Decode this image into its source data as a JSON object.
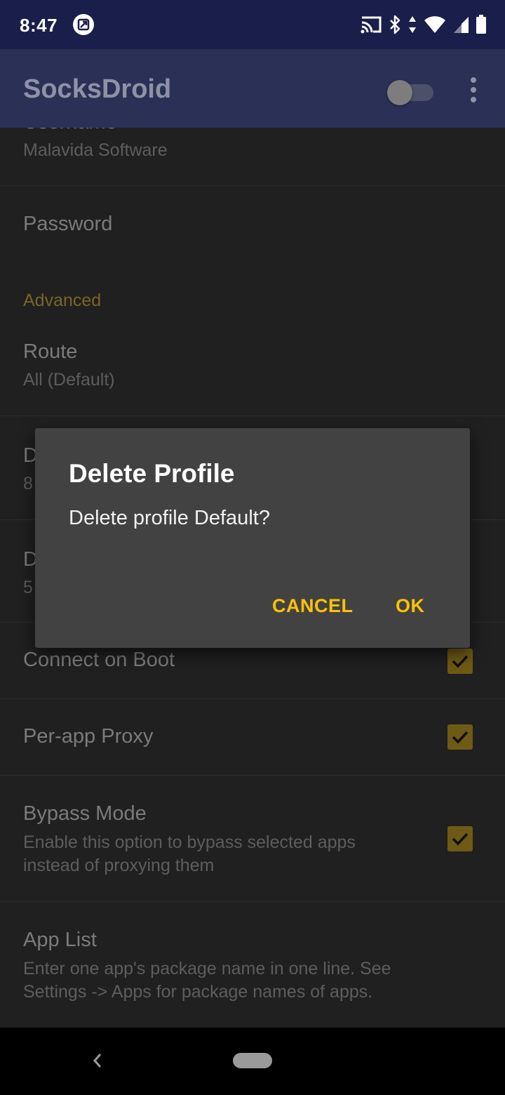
{
  "status_bar": {
    "time": "8:47",
    "icons": [
      "notification-app-icon",
      "cast-icon",
      "bluetooth-icon",
      "data-arrows-icon",
      "wifi-icon",
      "signal-icon",
      "battery-icon"
    ]
  },
  "app_bar": {
    "title": "SocksDroid",
    "toggle_on": false
  },
  "settings": {
    "username": {
      "title": "Username",
      "summary": "Malavida Software"
    },
    "password": {
      "title": "Password"
    },
    "advanced_category": "Advanced",
    "route": {
      "title": "Route",
      "summary": "All (Default)"
    },
    "dns_1": {
      "title_partial": "D",
      "summary_partial": "8"
    },
    "dns_2": {
      "title_partial": "D",
      "summary_partial": "5"
    },
    "connect_on_boot": {
      "title": "Connect on Boot",
      "checked": true
    },
    "per_app_proxy": {
      "title": "Per-app Proxy",
      "checked": true
    },
    "bypass_mode": {
      "title": "Bypass Mode",
      "summary_line1": "Enable this option to bypass selected apps",
      "summary_line2": "instead of proxying them",
      "checked": true
    },
    "app_list": {
      "title": "App List",
      "summary_line1": "Enter one app's package name in one line. See",
      "summary_line2": "Settings -> Apps for package names of apps."
    }
  },
  "dialog": {
    "title": "Delete Profile",
    "message": "Delete profile Default?",
    "cancel_label": "CANCEL",
    "ok_label": "OK"
  },
  "colors": {
    "accent": "#ffc107",
    "status_bar": "#1a1e4b",
    "app_bar": "#2b3057",
    "dialog_bg": "#424242"
  }
}
